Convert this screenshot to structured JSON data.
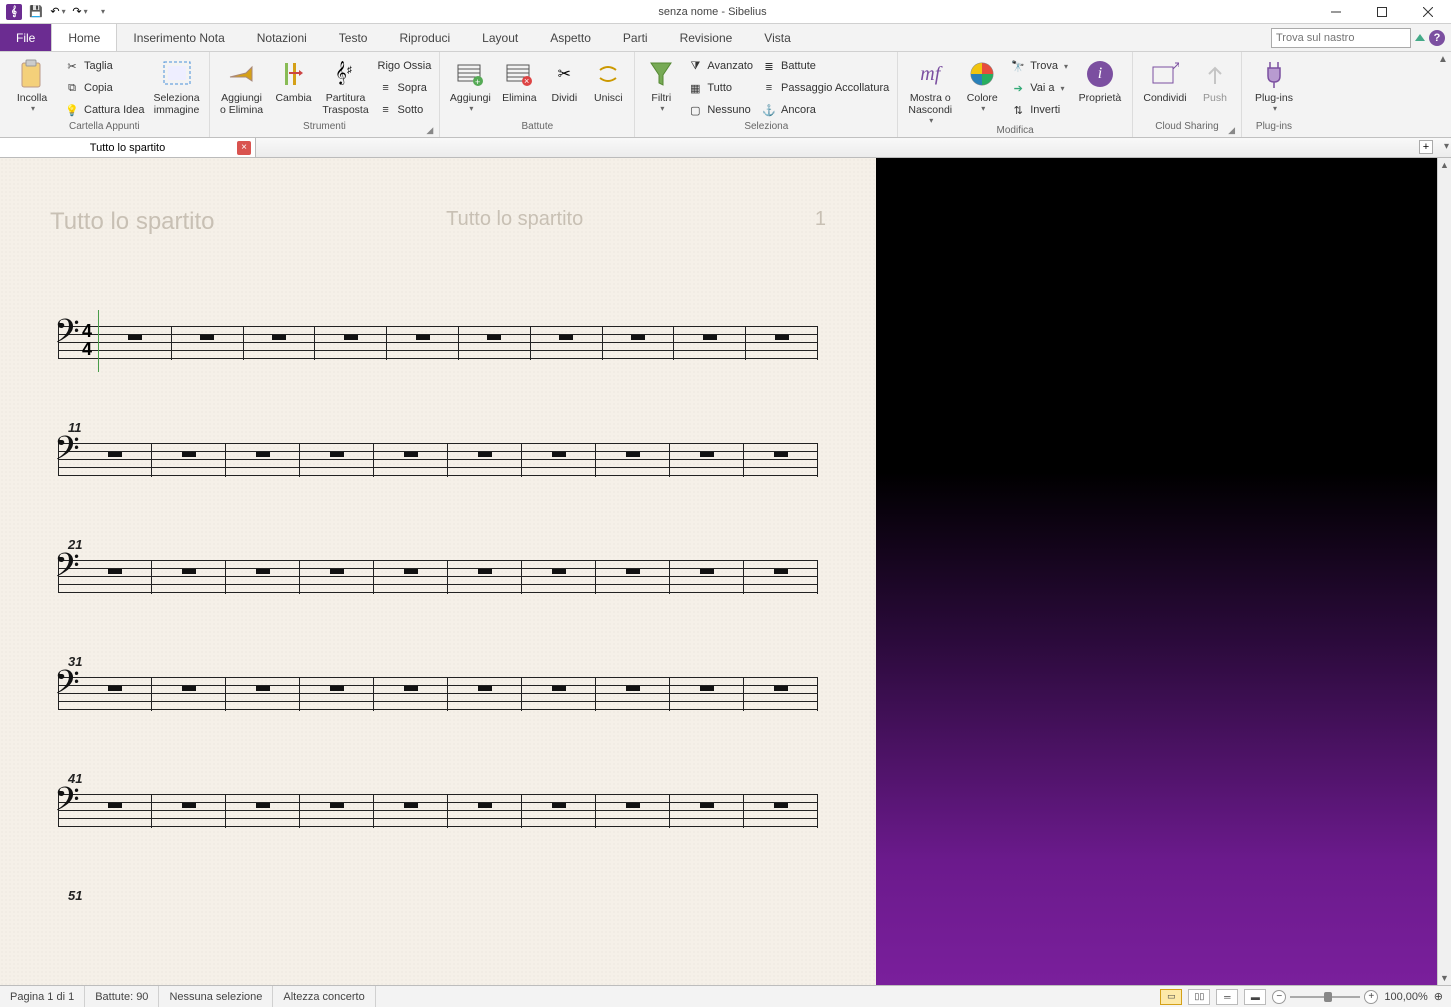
{
  "window": {
    "title": "senza nome - Sibelius"
  },
  "qat": {
    "save": "💾",
    "undo": "↶",
    "redo": "↷"
  },
  "tabs": {
    "file": "File",
    "items": [
      "Home",
      "Inserimento Nota",
      "Notazioni",
      "Testo",
      "Riproduci",
      "Layout",
      "Aspetto",
      "Parti",
      "Revisione",
      "Vista"
    ],
    "active": "Home",
    "search_placeholder": "Trova sul nastro"
  },
  "ribbon": {
    "clipboard": {
      "label": "Cartella Appunti",
      "paste": "Incolla",
      "cut": "Taglia",
      "copy": "Copia",
      "capture": "Cattura Idea",
      "select_image": "Seleziona\nimmagine"
    },
    "instruments": {
      "label": "Strumenti",
      "add_remove": "Aggiungi\no Elimina",
      "change": "Cambia",
      "transposing": "Partitura\nTrasposta",
      "ossia": "Rigo Ossia",
      "above": "Sopra",
      "below": "Sotto"
    },
    "bars": {
      "label": "Battute",
      "add": "Aggiungi",
      "delete": "Elimina",
      "split": "Dividi",
      "join": "Unisci"
    },
    "selection": {
      "label": "Seleziona",
      "filters": "Filtri",
      "advanced": "Avanzato",
      "all": "Tutto",
      "none": "Nessuno",
      "bars_btn": "Battute",
      "system_passage": "Passaggio Accollatura",
      "more": "Ancora"
    },
    "edit": {
      "label": "Modifica",
      "hide_show": "Mostra o\nNascondi",
      "color": "Colore",
      "find": "Trova",
      "goto": "Vai a",
      "flip": "Inverti",
      "inspector": "Proprietà"
    },
    "cloud": {
      "label": "Cloud Sharing",
      "share": "Condividi",
      "push": "Push"
    },
    "plugins": {
      "label": "Plug-ins",
      "btn": "Plug-ins"
    }
  },
  "doctab": {
    "name": "Tutto lo spartito"
  },
  "score": {
    "header_left": "Tutto lo spartito",
    "header_center": "Tutto lo spartito",
    "page_number": "1",
    "time_sig_top": "4",
    "time_sig_bottom": "4",
    "systems": [
      {
        "barnum": null,
        "first": true
      },
      {
        "barnum": "11",
        "first": false
      },
      {
        "barnum": "21",
        "first": false
      },
      {
        "barnum": "31",
        "first": false
      },
      {
        "barnum": "41",
        "first": false
      }
    ],
    "partial_barnum": "51",
    "bars_per_system": 10
  },
  "status": {
    "page": "Pagina 1 di 1",
    "bars": "Battute: 90",
    "selection": "Nessuna selezione",
    "pitch": "Altezza concerto",
    "zoom": "100,00%"
  }
}
